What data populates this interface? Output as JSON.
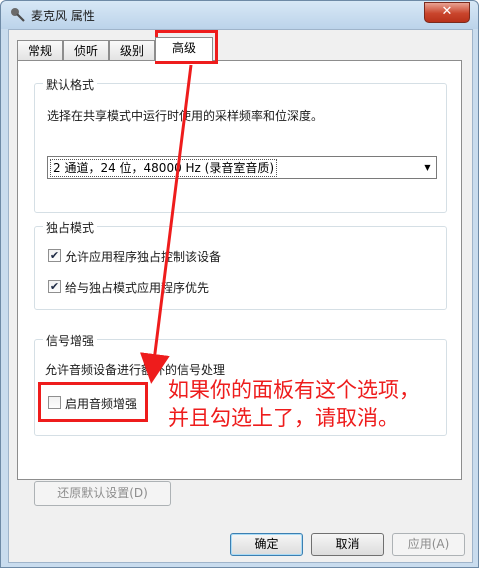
{
  "window": {
    "title": "麦克风 属性",
    "close_label": "✕"
  },
  "tabs": [
    {
      "label": "常规",
      "active": false
    },
    {
      "label": "侦听",
      "active": false
    },
    {
      "label": "级别",
      "active": false
    },
    {
      "label": "高级",
      "active": true
    }
  ],
  "default_format": {
    "group_label": "默认格式",
    "description": "选择在共享模式中运行时使用的采样频率和位深度。",
    "selected_value": "2 通道，24 位，48000 Hz (录音室音质)"
  },
  "exclusive_mode": {
    "group_label": "独占模式",
    "options": [
      {
        "label": "允许应用程序独占控制该设备",
        "checked": true
      },
      {
        "label": "给与独占模式应用程序优先",
        "checked": true
      }
    ]
  },
  "signal_enhancement": {
    "group_label": "信号增强",
    "description": "允许音频设备进行额外的信号处理",
    "option": {
      "label": "启用音频增强",
      "checked": false
    }
  },
  "buttons": {
    "restore_defaults": "还原默认设置(D)",
    "ok": "确定",
    "cancel": "取消",
    "apply": "应用(A)"
  },
  "annotation": {
    "line1": "如果你的面板有这个选项，",
    "line2": "并且勾选上了，请取消。",
    "color": "#ee1c1c"
  }
}
